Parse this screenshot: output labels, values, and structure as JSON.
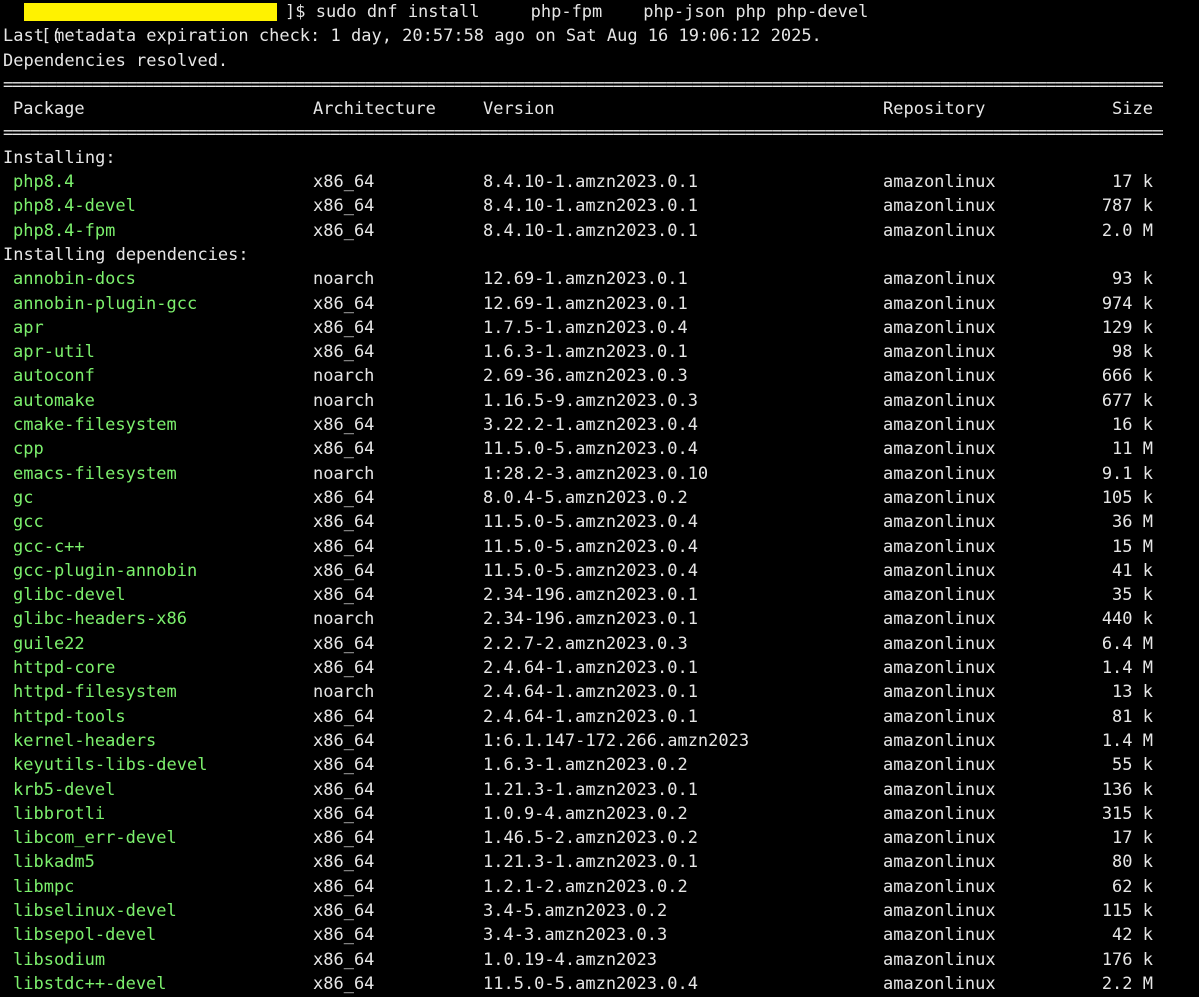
{
  "terminal": {
    "prompt_open": "[(",
    "prompt_close": "]$ sudo dnf install     php-fpm    php-json php php-devel",
    "lines": [
      "Last metadata expiration check: 1 day, 20:57:58 ago on Sat Aug 16 19:06:12 2025.",
      "Dependencies resolved."
    ],
    "rule": "================================================================================================================================================================",
    "headers": {
      "package": "Package",
      "architecture": "Architecture",
      "version": "Version",
      "repository": "Repository",
      "size": "Size"
    },
    "sections": [
      {
        "title": "Installing:",
        "rows": [
          {
            "name": "php8.4",
            "arch": "x86_64",
            "version": "8.4.10-1.amzn2023.0.1",
            "repo": "amazonlinux",
            "size": "17 k"
          },
          {
            "name": "php8.4-devel",
            "arch": "x86_64",
            "version": "8.4.10-1.amzn2023.0.1",
            "repo": "amazonlinux",
            "size": "787 k"
          },
          {
            "name": "php8.4-fpm",
            "arch": "x86_64",
            "version": "8.4.10-1.amzn2023.0.1",
            "repo": "amazonlinux",
            "size": "2.0 M"
          }
        ]
      },
      {
        "title": "Installing dependencies:",
        "rows": [
          {
            "name": "annobin-docs",
            "arch": "noarch",
            "version": "12.69-1.amzn2023.0.1",
            "repo": "amazonlinux",
            "size": "93 k"
          },
          {
            "name": "annobin-plugin-gcc",
            "arch": "x86_64",
            "version": "12.69-1.amzn2023.0.1",
            "repo": "amazonlinux",
            "size": "974 k"
          },
          {
            "name": "apr",
            "arch": "x86_64",
            "version": "1.7.5-1.amzn2023.0.4",
            "repo": "amazonlinux",
            "size": "129 k"
          },
          {
            "name": "apr-util",
            "arch": "x86_64",
            "version": "1.6.3-1.amzn2023.0.1",
            "repo": "amazonlinux",
            "size": "98 k"
          },
          {
            "name": "autoconf",
            "arch": "noarch",
            "version": "2.69-36.amzn2023.0.3",
            "repo": "amazonlinux",
            "size": "666 k"
          },
          {
            "name": "automake",
            "arch": "noarch",
            "version": "1.16.5-9.amzn2023.0.3",
            "repo": "amazonlinux",
            "size": "677 k"
          },
          {
            "name": "cmake-filesystem",
            "arch": "x86_64",
            "version": "3.22.2-1.amzn2023.0.4",
            "repo": "amazonlinux",
            "size": "16 k"
          },
          {
            "name": "cpp",
            "arch": "x86_64",
            "version": "11.5.0-5.amzn2023.0.4",
            "repo": "amazonlinux",
            "size": "11 M"
          },
          {
            "name": "emacs-filesystem",
            "arch": "noarch",
            "version": "1:28.2-3.amzn2023.0.10",
            "repo": "amazonlinux",
            "size": "9.1 k"
          },
          {
            "name": "gc",
            "arch": "x86_64",
            "version": "8.0.4-5.amzn2023.0.2",
            "repo": "amazonlinux",
            "size": "105 k"
          },
          {
            "name": "gcc",
            "arch": "x86_64",
            "version": "11.5.0-5.amzn2023.0.4",
            "repo": "amazonlinux",
            "size": "36 M"
          },
          {
            "name": "gcc-c++",
            "arch": "x86_64",
            "version": "11.5.0-5.amzn2023.0.4",
            "repo": "amazonlinux",
            "size": "15 M"
          },
          {
            "name": "gcc-plugin-annobin",
            "arch": "x86_64",
            "version": "11.5.0-5.amzn2023.0.4",
            "repo": "amazonlinux",
            "size": "41 k"
          },
          {
            "name": "glibc-devel",
            "arch": "x86_64",
            "version": "2.34-196.amzn2023.0.1",
            "repo": "amazonlinux",
            "size": "35 k"
          },
          {
            "name": "glibc-headers-x86",
            "arch": "noarch",
            "version": "2.34-196.amzn2023.0.1",
            "repo": "amazonlinux",
            "size": "440 k"
          },
          {
            "name": "guile22",
            "arch": "x86_64",
            "version": "2.2.7-2.amzn2023.0.3",
            "repo": "amazonlinux",
            "size": "6.4 M"
          },
          {
            "name": "httpd-core",
            "arch": "x86_64",
            "version": "2.4.64-1.amzn2023.0.1",
            "repo": "amazonlinux",
            "size": "1.4 M"
          },
          {
            "name": "httpd-filesystem",
            "arch": "noarch",
            "version": "2.4.64-1.amzn2023.0.1",
            "repo": "amazonlinux",
            "size": "13 k"
          },
          {
            "name": "httpd-tools",
            "arch": "x86_64",
            "version": "2.4.64-1.amzn2023.0.1",
            "repo": "amazonlinux",
            "size": "81 k"
          },
          {
            "name": "kernel-headers",
            "arch": "x86_64",
            "version": "1:6.1.147-172.266.amzn2023",
            "repo": "amazonlinux",
            "size": "1.4 M"
          },
          {
            "name": "keyutils-libs-devel",
            "arch": "x86_64",
            "version": "1.6.3-1.amzn2023.0.2",
            "repo": "amazonlinux",
            "size": "55 k"
          },
          {
            "name": "krb5-devel",
            "arch": "x86_64",
            "version": "1.21.3-1.amzn2023.0.1",
            "repo": "amazonlinux",
            "size": "136 k"
          },
          {
            "name": "libbrotli",
            "arch": "x86_64",
            "version": "1.0.9-4.amzn2023.0.2",
            "repo": "amazonlinux",
            "size": "315 k"
          },
          {
            "name": "libcom_err-devel",
            "arch": "x86_64",
            "version": "1.46.5-2.amzn2023.0.2",
            "repo": "amazonlinux",
            "size": "17 k"
          },
          {
            "name": "libkadm5",
            "arch": "x86_64",
            "version": "1.21.3-1.amzn2023.0.1",
            "repo": "amazonlinux",
            "size": "80 k"
          },
          {
            "name": "libmpc",
            "arch": "x86_64",
            "version": "1.2.1-2.amzn2023.0.2",
            "repo": "amazonlinux",
            "size": "62 k"
          },
          {
            "name": "libselinux-devel",
            "arch": "x86_64",
            "version": "3.4-5.amzn2023.0.2",
            "repo": "amazonlinux",
            "size": "115 k"
          },
          {
            "name": "libsepol-devel",
            "arch": "x86_64",
            "version": "3.4-3.amzn2023.0.3",
            "repo": "amazonlinux",
            "size": "42 k"
          },
          {
            "name": "libsodium",
            "arch": "x86_64",
            "version": "1.0.19-4.amzn2023",
            "repo": "amazonlinux",
            "size": "176 k"
          },
          {
            "name": "libstdc++-devel",
            "arch": "x86_64",
            "version": "11.5.0-5.amzn2023.0.4",
            "repo": "amazonlinux",
            "size": "2.2 M"
          }
        ]
      }
    ],
    "colors": {
      "background": "#000000",
      "text": "#e6e6e6",
      "package_name": "#7cf06d",
      "redaction": "#fff200"
    }
  }
}
